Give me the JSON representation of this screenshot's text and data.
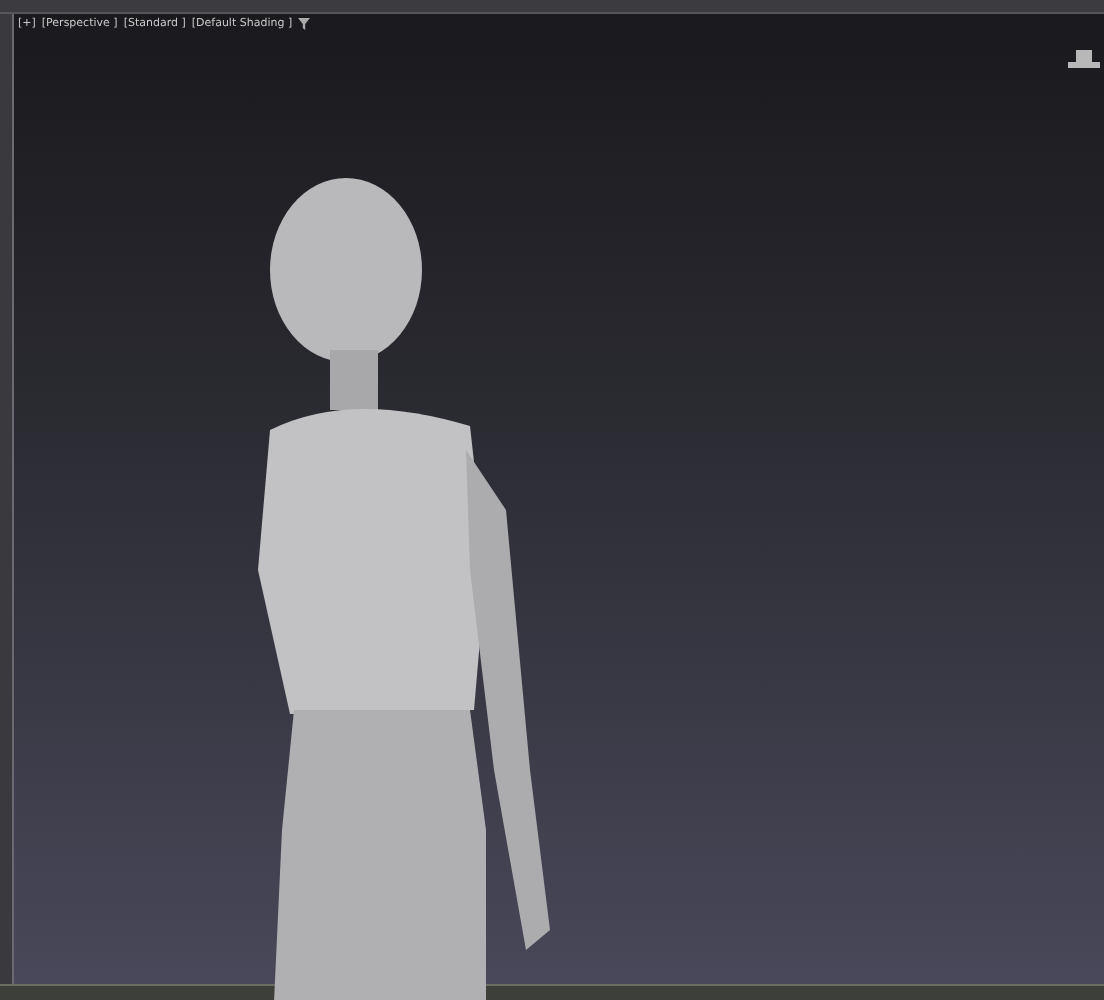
{
  "viewport": {
    "labels": [
      {
        "text": "[+]"
      },
      {
        "text": "[Perspective ]"
      },
      {
        "text": "[Standard ]"
      },
      {
        "text": "[Default Shading ]"
      }
    ]
  }
}
